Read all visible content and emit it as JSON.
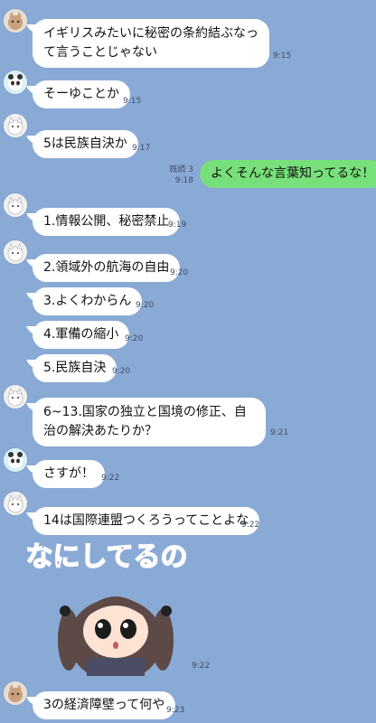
{
  "messages": [
    {
      "text": "イギリスみたいに秘密の条約結ぶなって言うことじゃない",
      "time": "9:15"
    },
    {
      "text": "そーゆことか",
      "time": "9:15"
    },
    {
      "text": "5は民族自決か",
      "time": "9:17"
    },
    {
      "text": "よくそんな言葉知ってるな！",
      "time": "9:18",
      "read": "既読 3"
    },
    {
      "text": "1.情報公開、秘密禁止",
      "time": "9:19"
    },
    {
      "text": "2.領域外の航海の自由",
      "time": "9:20"
    },
    {
      "text": "3.よくわからん",
      "time": "9:20"
    },
    {
      "text": "4.軍備の縮小",
      "time": "9:20"
    },
    {
      "text": "5.民族自決",
      "time": "9:20"
    },
    {
      "text": "6~13.国家の独立と国境の修正、自治の解決あたりか？",
      "time": "9:21"
    },
    {
      "text": "さすが！",
      "time": "9:22"
    },
    {
      "text": "14は国際連盟つくろうってことよな",
      "time": "9:22"
    },
    {
      "sticker_text": "なにしてるの",
      "time": "9:22"
    },
    {
      "text": "3の経済障壁って何や",
      "time": "9:23"
    }
  ],
  "colors": {
    "background": "#8aaad6",
    "incoming_bubble": "#ffffff",
    "outgoing_bubble": "#77e07a",
    "sticker_text": "#5b2a8c"
  },
  "icons": {
    "avatar_a": "cat-avatar-icon",
    "avatar_b": "panda-avatar-icon",
    "sticker": "girl-sticker-icon"
  }
}
